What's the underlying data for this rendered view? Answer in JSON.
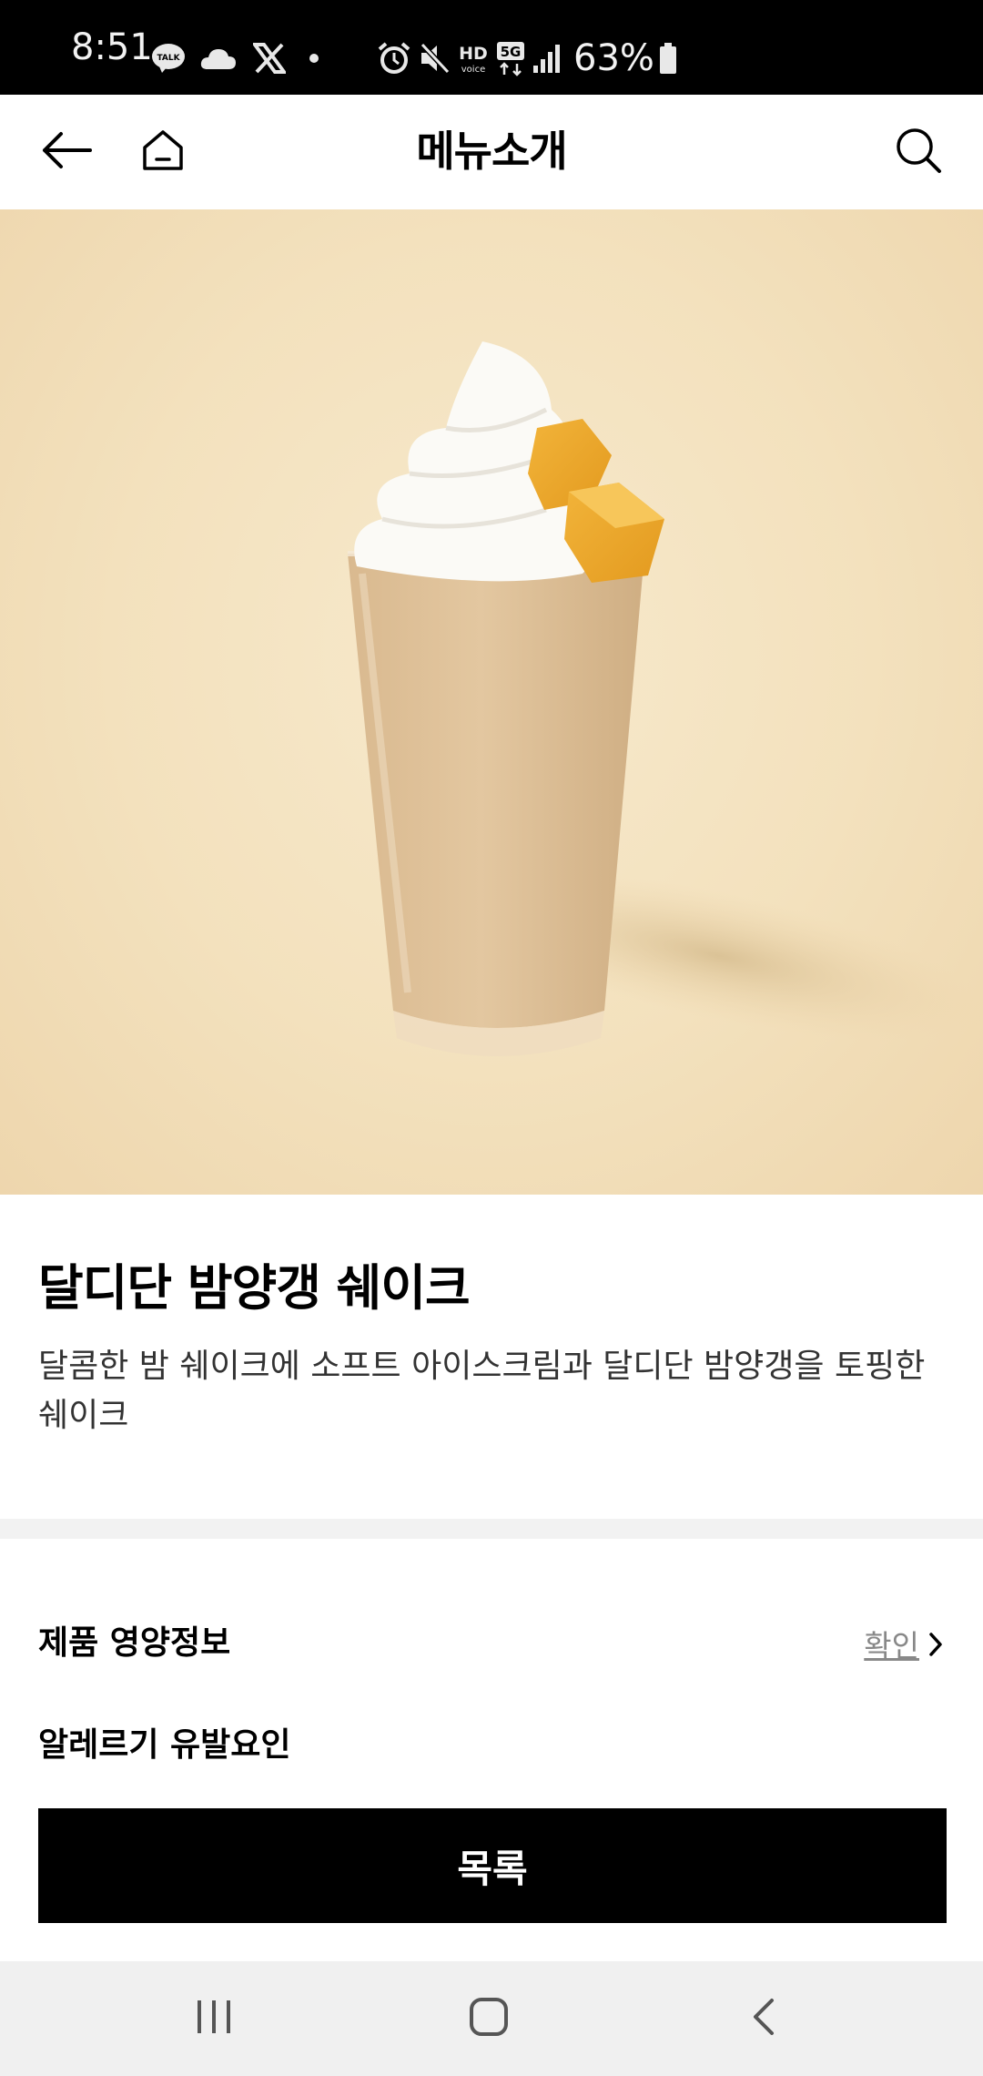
{
  "status_bar": {
    "time": "8:51",
    "battery": "63%",
    "icons": [
      "kakaotalk-icon",
      "cloud-icon",
      "x-icon",
      "dot-icon",
      "alarm-icon",
      "mute-icon",
      "hd-voice-icon",
      "5g-icon",
      "signal-icon",
      "battery-icon"
    ],
    "talk_badge": "TALK"
  },
  "header": {
    "title": "메뉴소개",
    "icons": [
      "back-arrow-icon",
      "home-icon",
      "search-icon"
    ]
  },
  "product": {
    "name": "달디단 밤양갱 쉐이크",
    "description": " 달콤한 밤 쉐이크에 소프트 아이스크림과 달디단 밤양갱을 토핑한 쉐이크"
  },
  "nutrition": {
    "label": "제품 영양정보",
    "link_label": "확인"
  },
  "allergy": {
    "label": "알레르기 유발요인"
  },
  "list_button": {
    "label": "목록"
  },
  "nav_bar": {
    "icons": [
      "recent-apps-icon",
      "home-nav-icon",
      "back-nav-icon"
    ]
  },
  "colors": {
    "hero_background": "#f3e1bd",
    "button_background": "#000000",
    "divider": "#f2f2f2",
    "nav_background": "#f0f0f0"
  }
}
